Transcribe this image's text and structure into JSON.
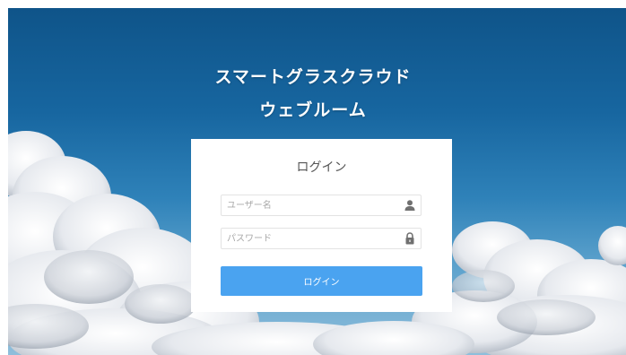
{
  "app": {
    "title_line1": "スマートグラスクラウド",
    "title_line2": "ウェブルーム"
  },
  "login": {
    "heading": "ログイン",
    "username": {
      "value": "",
      "placeholder": "ユーザー名",
      "icon": "user-icon"
    },
    "password": {
      "value": "",
      "placeholder": "パスワード",
      "icon": "lock-icon"
    },
    "submit_label": "ログイン"
  },
  "colors": {
    "accent": "#4aa3f0",
    "sky_top": "#0f5489",
    "sky_bottom": "#8fbedb",
    "card_background": "#ffffff",
    "icon": "#707070"
  }
}
